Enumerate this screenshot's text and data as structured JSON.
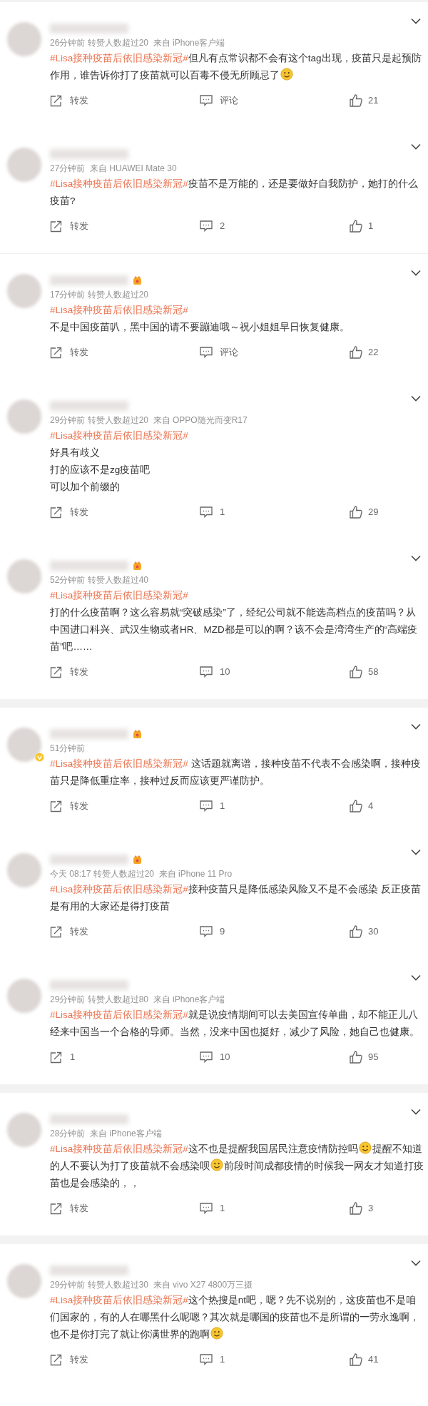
{
  "posts": [
    {
      "badge": false,
      "verified": false,
      "meta": "26分钟前 转赞人数超过20  来自 iPhone客户端",
      "paragraphs": [
        [
          {
            "kind": "tag",
            "text": "#Lisa接种疫苗后依旧感染新冠#"
          },
          {
            "kind": "text",
            "text": "但凡有点常识都不会有这个tag出现，疫苗只是起预防作用，谁告诉你打了疫苗就可以百毒不侵无所顾忌了"
          },
          {
            "kind": "emoji"
          }
        ]
      ],
      "actions": {
        "repost": "转发",
        "comment": "评论",
        "likes": "21"
      }
    },
    {
      "badge": false,
      "verified": false,
      "meta": "27分钟前  来自 HUAWEI Mate 30",
      "paragraphs": [
        [
          {
            "kind": "tag",
            "text": "#Lisa接种疫苗后依旧感染新冠#"
          },
          {
            "kind": "text",
            "text": "疫苗不是万能的，还是要做好自我防护，她打的什么疫苗?"
          }
        ]
      ],
      "actions": {
        "repost": "转发",
        "comment": "2",
        "likes": "1"
      }
    },
    {
      "kind": "line"
    },
    {
      "badge": true,
      "verified": false,
      "meta": "17分钟前 转赞人数超过20",
      "paragraphs": [
        [
          {
            "kind": "tag",
            "text": "#Lisa接种疫苗后依旧感染新冠#"
          }
        ],
        [
          {
            "kind": "text",
            "text": "不是中国疫苗叭，黑中国的请不要蹦迪哦～祝小姐姐早日恢复健康。"
          }
        ]
      ],
      "actions": {
        "repost": "转发",
        "comment": "评论",
        "likes": "22"
      }
    },
    {
      "badge": false,
      "verified": false,
      "meta": "29分钟前 转赞人数超过20  来自 OPPO随光而变R17",
      "paragraphs": [
        [
          {
            "kind": "tag",
            "text": "#Lisa接种疫苗后依旧感染新冠#"
          }
        ],
        [
          {
            "kind": "text",
            "text": "好具有歧义"
          }
        ],
        [
          {
            "kind": "text",
            "text": "打的应该不是zg疫苗吧"
          }
        ],
        [
          {
            "kind": "text",
            "text": "可以加个前缀的"
          }
        ]
      ],
      "actions": {
        "repost": "转发",
        "comment": "1",
        "likes": "29"
      }
    },
    {
      "badge": true,
      "verified": false,
      "meta": "52分钟前 转赞人数超过40",
      "paragraphs": [
        [
          {
            "kind": "tag",
            "text": "#Lisa接种疫苗后依旧感染新冠#"
          }
        ],
        [
          {
            "kind": "text",
            "text": "打的什么疫苗啊？这么容易就“突破感染”了，经纪公司就不能选高档点的疫苗吗？从中国进口科兴、武汉生物或者HR、MZD都是可以的啊？该不会是湾湾生产的“高端疫苗”吧……"
          }
        ]
      ],
      "actions": {
        "repost": "转发",
        "comment": "10",
        "likes": "58"
      }
    },
    {
      "kind": "band"
    },
    {
      "badge": true,
      "verified": true,
      "meta": "51分钟前",
      "paragraphs": [
        [
          {
            "kind": "tag",
            "text": "#Lisa接种疫苗后依旧感染新冠#"
          },
          {
            "kind": "text",
            "text": " 这话题就离谱，接种疫苗不代表不会感染啊，接种疫苗只是降低重症率，接种过反而应该更严谨防护。"
          }
        ]
      ],
      "actions": {
        "repost": "转发",
        "comment": "1",
        "likes": "4"
      }
    },
    {
      "badge": true,
      "verified": false,
      "meta": "今天 08:17 转赞人数超过20  来自 iPhone 11 Pro",
      "paragraphs": [
        [
          {
            "kind": "tag",
            "text": "#Lisa接种疫苗后依旧感染新冠#"
          },
          {
            "kind": "text",
            "text": "接种疫苗只是降低感染风险又不是不会感染 反正疫苗是有用的大家还是得打疫苗"
          }
        ]
      ],
      "actions": {
        "repost": "转发",
        "comment": "9",
        "likes": "30"
      }
    },
    {
      "badge": false,
      "verified": false,
      "meta": "29分钟前 转赞人数超过80  来自 iPhone客户端",
      "paragraphs": [
        [
          {
            "kind": "tag",
            "text": "#Lisa接种疫苗后依旧感染新冠#"
          },
          {
            "kind": "text",
            "text": "就是说疫情期间可以去美国宣传单曲，却不能正儿八经来中国当一个合格的导师。当然，没来中国也挺好，减少了风险，她自己也健康。"
          }
        ]
      ],
      "actions": {
        "repost": "1",
        "comment": "10",
        "likes": "95"
      }
    },
    {
      "kind": "band"
    },
    {
      "badge": false,
      "verified": false,
      "meta": "28分钟前  来自 iPhone客户端",
      "paragraphs": [
        [
          {
            "kind": "tag",
            "text": "#Lisa接种疫苗后依旧感染新冠#"
          },
          {
            "kind": "text",
            "text": "这不也是提醒我国居民注意疫情防控吗"
          },
          {
            "kind": "emoji"
          },
          {
            "kind": "text",
            "text": "提醒不知道的人不要认为打了疫苗就不会感染呗"
          },
          {
            "kind": "emoji"
          },
          {
            "kind": "text",
            "text": "前段时间成都疫情的时候我一网友才知道打疫苗也是会感染的，，"
          }
        ]
      ],
      "actions": {
        "repost": "转发",
        "comment": "1",
        "likes": "3"
      }
    },
    {
      "kind": "band"
    },
    {
      "badge": false,
      "verified": false,
      "meta": "29分钟前 转赞人数超过30  来自 vivo X27 4800万三摄",
      "paragraphs": [
        [
          {
            "kind": "tag",
            "text": "#Lisa接种疫苗后依旧感染新冠#"
          },
          {
            "kind": "text",
            "text": "这个热搜是nt吧，嗯？先不说别的，这疫苗也不是咱们国家的，有的人在哪黑什么呢嗯？其次就是哪国的疫苗也不是所谓的一劳永逸啊，也不是你打完了就让你满世界的跑啊"
          },
          {
            "kind": "emoji"
          }
        ]
      ],
      "actions": {
        "repost": "转发",
        "comment": "1",
        "likes": "41"
      }
    }
  ]
}
